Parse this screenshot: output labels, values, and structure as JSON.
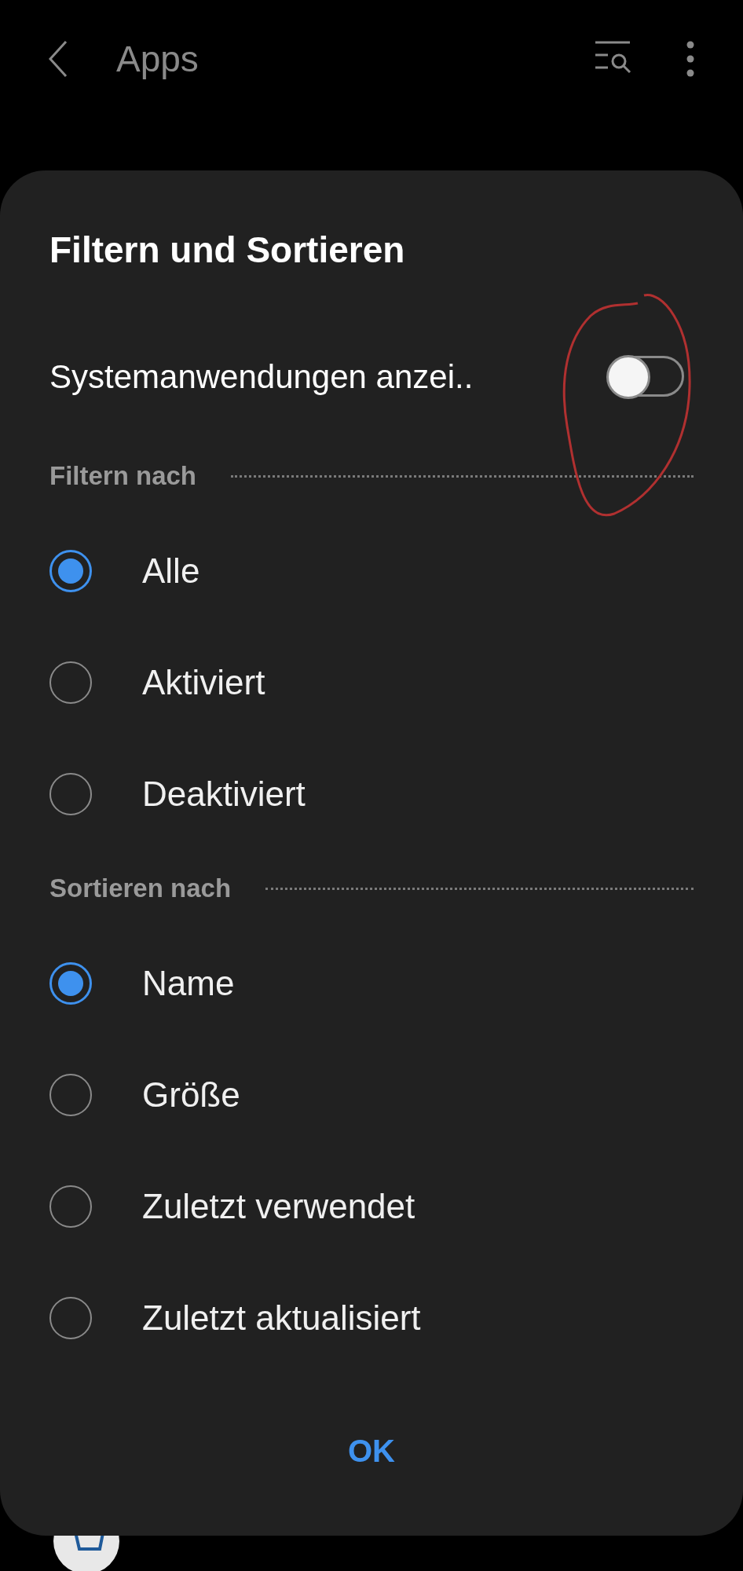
{
  "app_bar": {
    "title": "Apps"
  },
  "dialog": {
    "title": "Filtern und Sortieren",
    "toggle": {
      "label": "Systemanwendungen anzei..",
      "on": false
    },
    "sections": [
      {
        "heading": "Filtern nach",
        "options": [
          {
            "label": "Alle",
            "selected": true
          },
          {
            "label": "Aktiviert",
            "selected": false
          },
          {
            "label": "Deaktiviert",
            "selected": false
          }
        ]
      },
      {
        "heading": "Sortieren nach",
        "options": [
          {
            "label": "Name",
            "selected": true
          },
          {
            "label": "Größe",
            "selected": false
          },
          {
            "label": "Zuletzt verwendet",
            "selected": false
          },
          {
            "label": "Zuletzt aktualisiert",
            "selected": false
          }
        ]
      }
    ],
    "ok_button": "OK"
  }
}
